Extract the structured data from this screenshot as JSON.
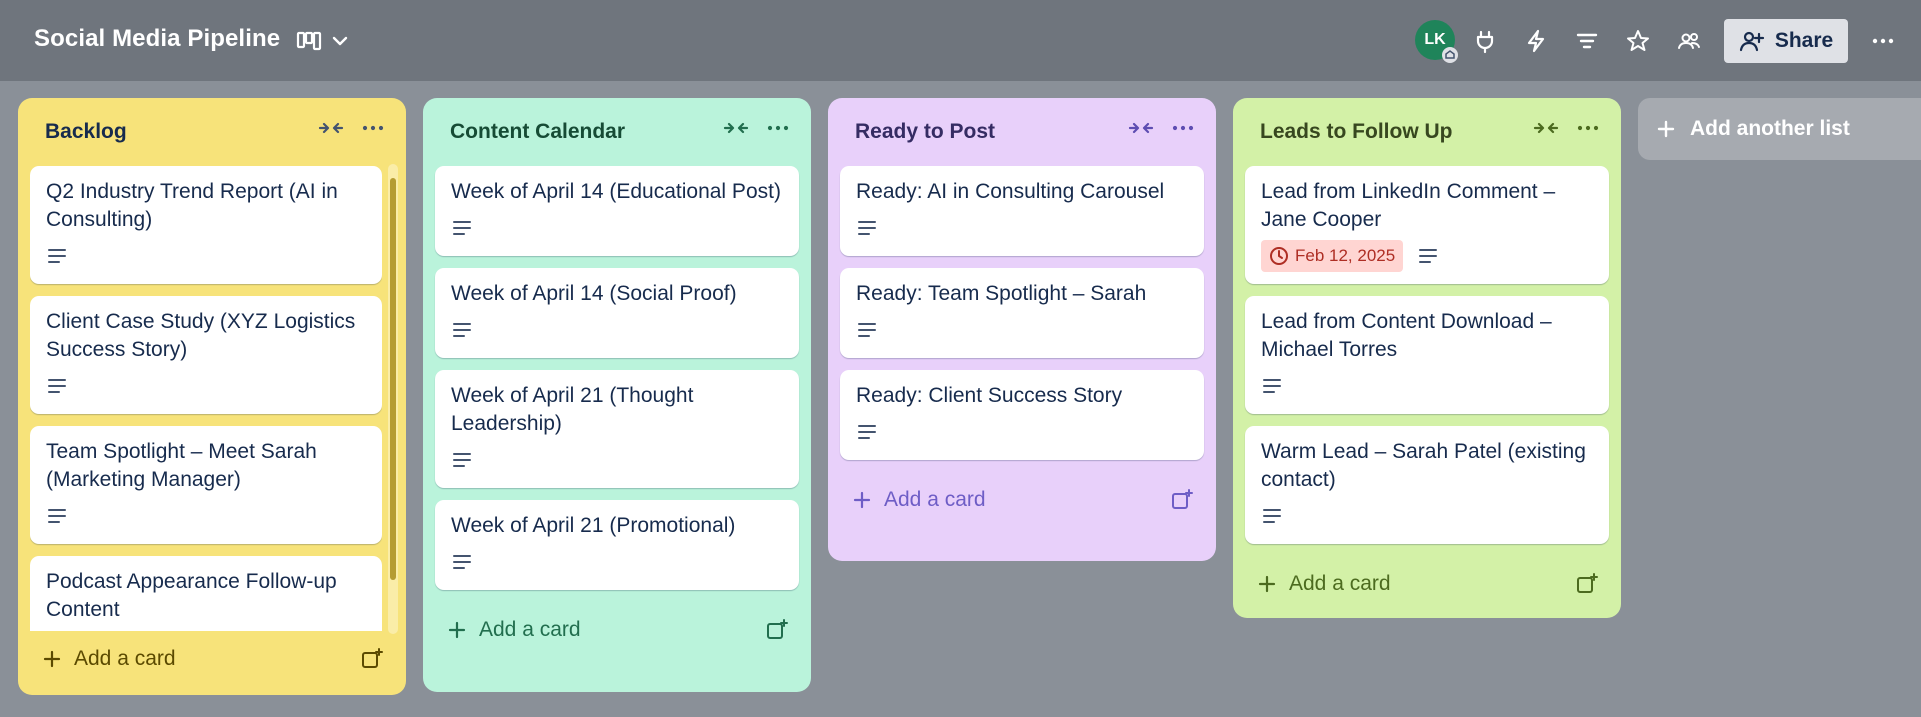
{
  "header": {
    "board_title": "Social Media Pipeline",
    "avatar_initials": "LK",
    "share_label": "Share"
  },
  "colors": {
    "backlog": "#f7e37a",
    "content_calendar": "#baf3db",
    "ready_to_post": "#e8d0fa",
    "leads": "#d3f1a7"
  },
  "lists": [
    {
      "title": "Backlog",
      "add_label": "Add a card",
      "cards": [
        {
          "title": "Q2 Industry Trend Report (AI in Consulting)"
        },
        {
          "title": "Client Case Study (XYZ Logistics Success Story)"
        },
        {
          "title": "Team Spotlight – Meet Sarah (Marketing Manager)"
        },
        {
          "title": "Podcast Appearance Follow-up Content"
        }
      ]
    },
    {
      "title": "Content Calendar",
      "add_label": "Add a card",
      "cards": [
        {
          "title": "Week of April 14 (Educational Post)"
        },
        {
          "title": "Week of April 14 (Social Proof)"
        },
        {
          "title": "Week of April 21 (Thought Leadership)"
        },
        {
          "title": "Week of April 21 (Promotional)"
        }
      ]
    },
    {
      "title": "Ready to Post",
      "add_label": "Add a card",
      "cards": [
        {
          "title": "Ready: AI in Consulting Carousel"
        },
        {
          "title": "Ready: Team Spotlight – Sarah"
        },
        {
          "title": "Ready: Client Success Story"
        }
      ]
    },
    {
      "title": "Leads to Follow Up",
      "add_label": "Add a card",
      "cards": [
        {
          "title": "Lead from LinkedIn Comment – Jane Cooper",
          "due": "Feb 12, 2025"
        },
        {
          "title": "Lead from Content Download – Michael Torres"
        },
        {
          "title": "Warm Lead – Sarah Patel (existing contact)"
        }
      ]
    }
  ],
  "add_list_label": "Add another list"
}
